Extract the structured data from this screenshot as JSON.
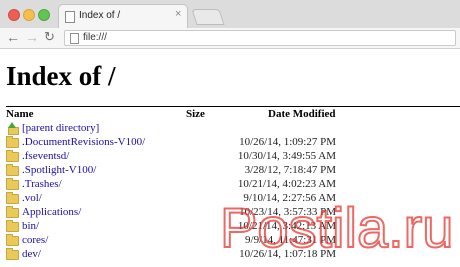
{
  "window": {
    "controls": [
      "close",
      "minimize",
      "zoom"
    ],
    "tab": {
      "title": "Index of /",
      "icon": "page-icon",
      "close_glyph": "×"
    }
  },
  "toolbar": {
    "back_glyph": "←",
    "forward_glyph": "→",
    "reload_glyph": "↻",
    "url": "file:///"
  },
  "page": {
    "title": "Index of /",
    "columns": {
      "name": "Name",
      "size": "Size",
      "date": "Date Modified"
    },
    "parent": {
      "label": "[parent directory]",
      "icon": "up-folder-icon"
    },
    "entries": [
      {
        "name": ".DocumentRevisions-V100/",
        "date": "10/26/14, 1:09:27 PM"
      },
      {
        "name": ".fseventsd/",
        "date": "10/30/14, 3:49:55 AM"
      },
      {
        "name": ".Spotlight-V100/",
        "date": "3/28/12, 7:18:47 PM"
      },
      {
        "name": ".Trashes/",
        "date": "10/21/14, 4:02:23 AM"
      },
      {
        "name": ".vol/",
        "date": "9/10/14, 2:27:56 AM"
      },
      {
        "name": "Applications/",
        "date": "10/23/14, 3:57:33 PM"
      },
      {
        "name": "bin/",
        "date": "10/21/14, 3:42:13 AM"
      },
      {
        "name": "cores/",
        "date": "9/9/14, 11:47:31 PM"
      },
      {
        "name": "dev/",
        "date": "10/26/14, 1:07:18 PM"
      }
    ]
  },
  "watermark": {
    "text": "Postila.ru",
    "color": "#e8352f"
  },
  "colors": {
    "link": "#1a0dab",
    "folder": "#e8c95a",
    "chrome": "#dcdcdc"
  }
}
